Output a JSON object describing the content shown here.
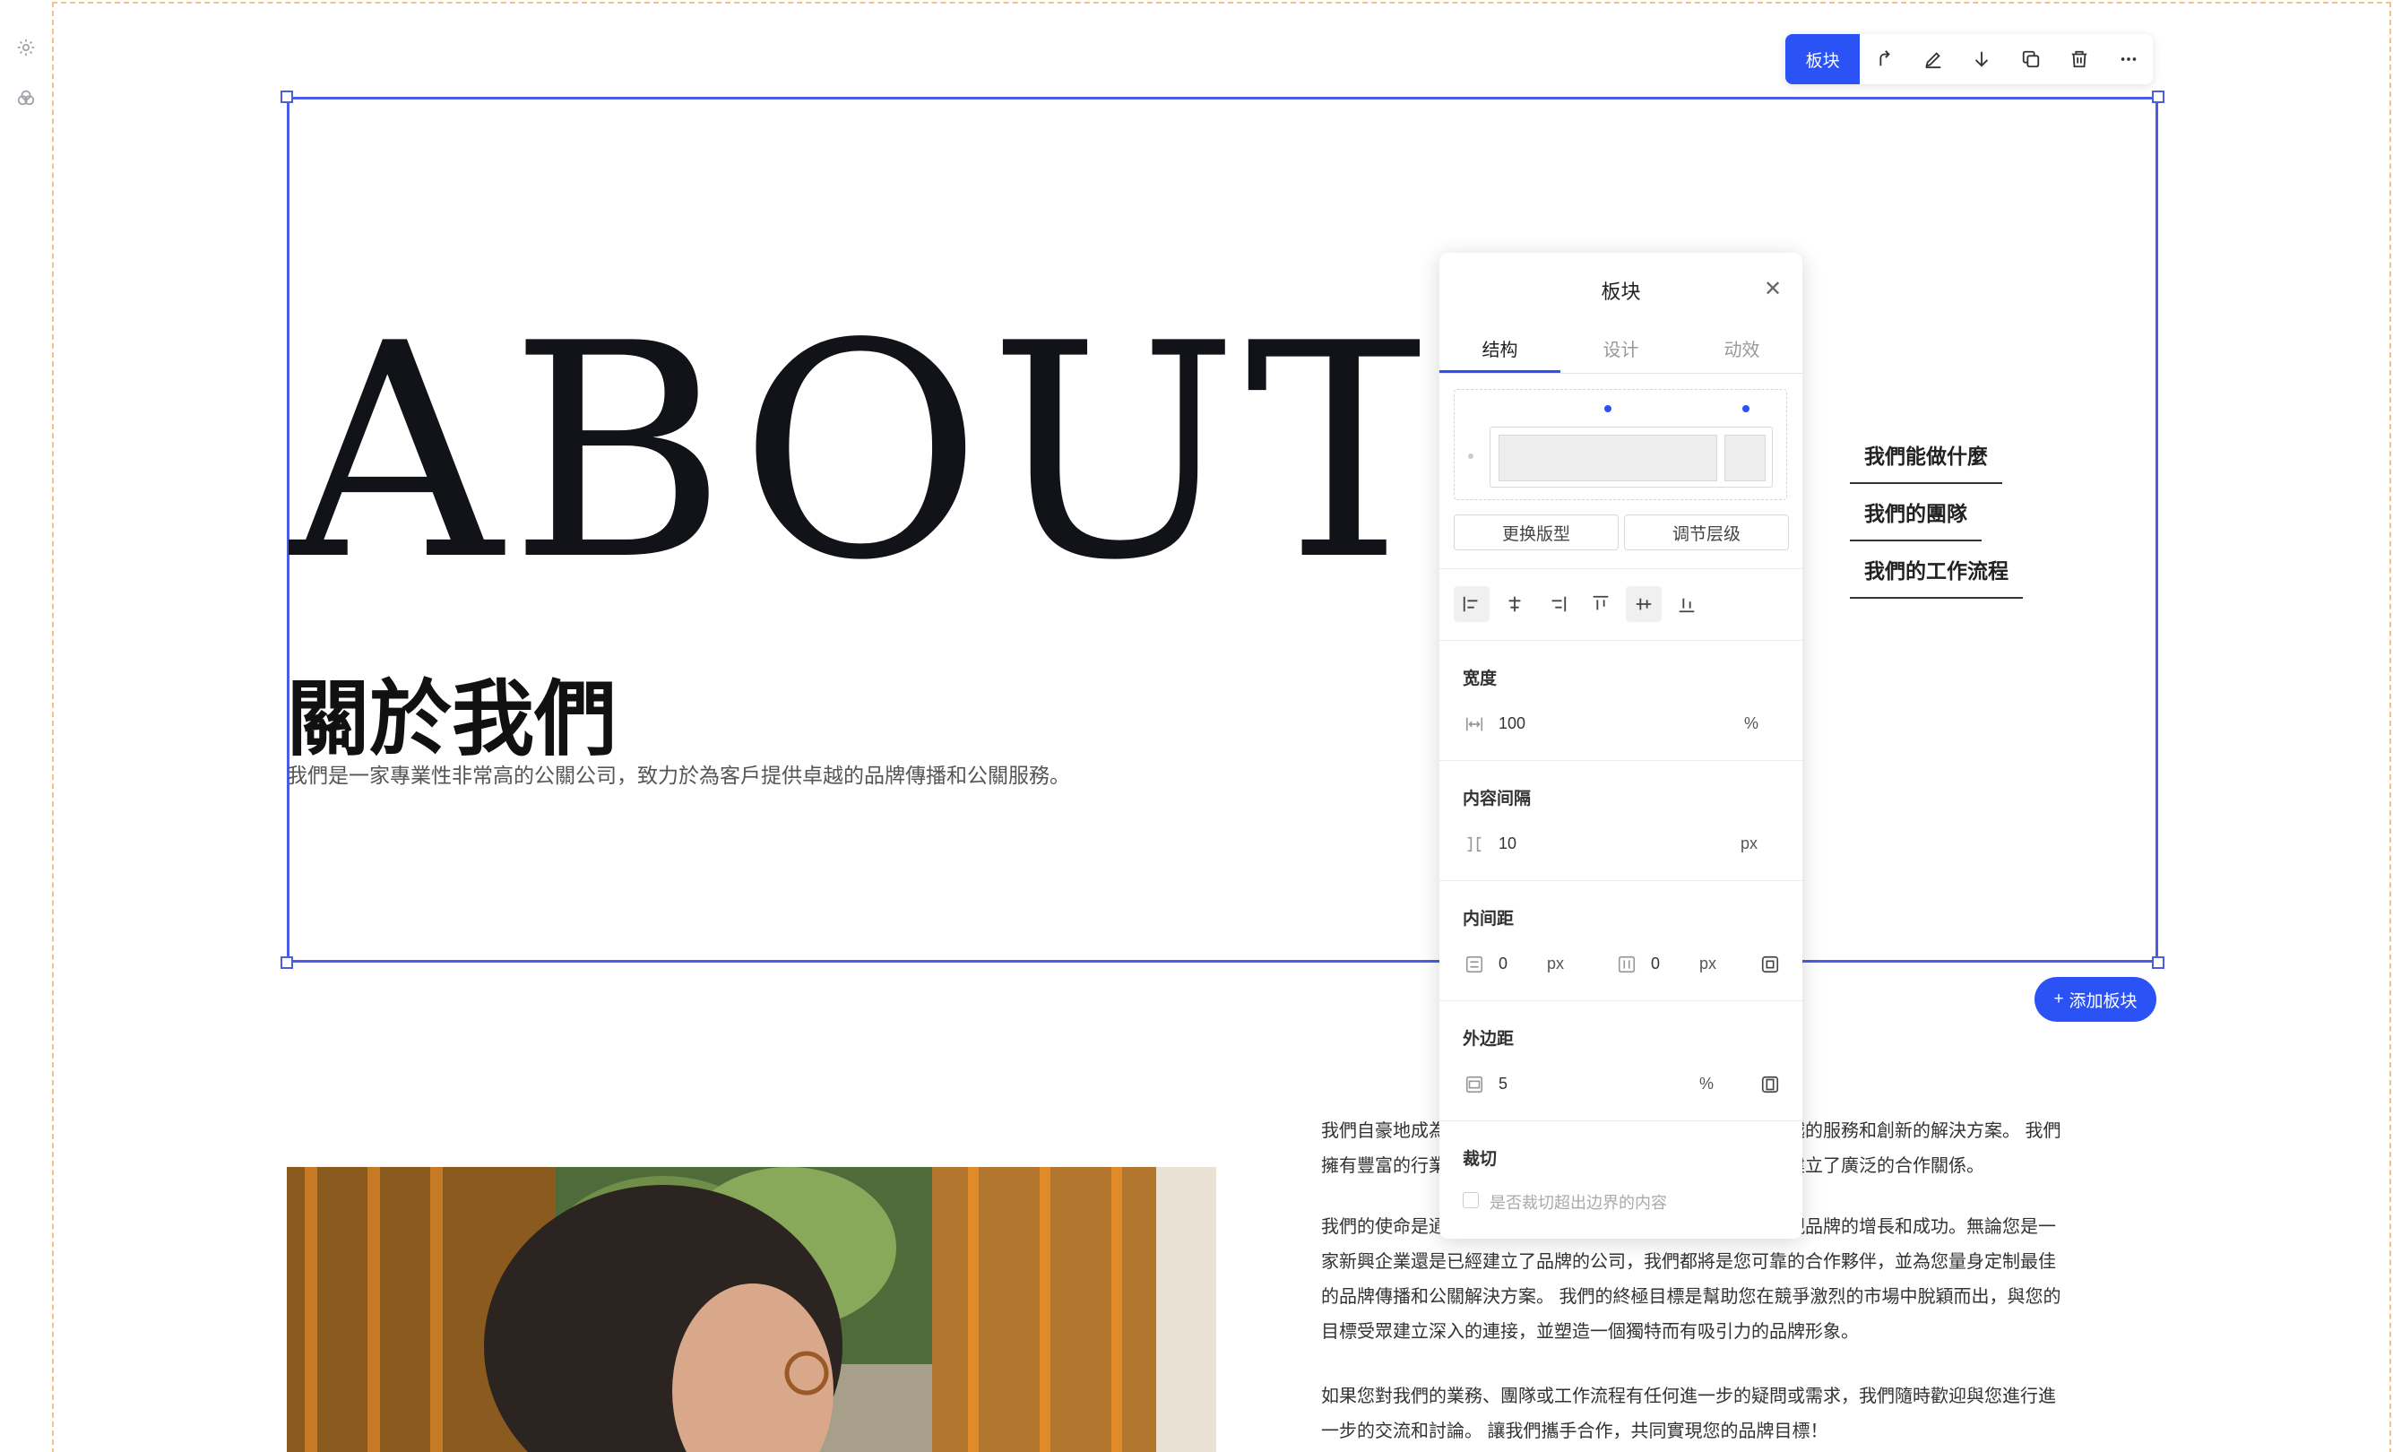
{
  "toolbar": {
    "block_label": "板块",
    "icons": [
      "move-up-icon",
      "edit-icon",
      "move-down-icon",
      "copy-icon",
      "delete-icon",
      "more-icon"
    ]
  },
  "hero": {
    "big_title": "ABOUT US",
    "cn_title": "關於我們",
    "cn_subtitle": "我們是一家專業性非常高的公關公司，致力於為客戶提供卓越的品牌傳播和公關服務。"
  },
  "side_nav": [
    "我們能做什麼",
    "我們的團隊",
    "我們的工作流程"
  ],
  "add_block_label": "添加板块",
  "paragraphs": [
    "我們自豪地成為一家專業的公關公司，為客戶提供專業、卓越的服務和創新的解決方案。 我們擁有豐富的行業經驗和專業的團隊，與眾多知名品牌和企業建立了廣泛的合作關係。",
    "我們的使命是通過專業的公關服務和傳播策略，幫助客戶實現品牌的增長和成功。無論您是一家新興企業還是已經建立了品牌的公司，我們都將是您可靠的合作夥伴，並為您量身定制最佳的品牌傳播和公關解決方案。 我們的終極目標是幫助您在競爭激烈的市場中脫穎而出，與您的目標受眾建立深入的連接，並塑造一個獨特而有吸引力的品牌形象。",
    "如果您對我們的業務、團隊或工作流程有任何進一步的疑問或需求，我們隨時歡迎與您進行進一步的交流和討論。 讓我們攜手合作，共同實現您的品牌目標！"
  ],
  "panel": {
    "title": "板块",
    "tabs": [
      "结构",
      "设计",
      "动效"
    ],
    "active_tab": "结构",
    "change_layout": "更换版型",
    "adjust_level": "调节层级",
    "width": {
      "label": "宽度",
      "value": "100",
      "unit": "%"
    },
    "gap": {
      "label": "内容间隔",
      "value": "10",
      "unit": "px"
    },
    "padding": {
      "label": "内间距",
      "v_value": "0",
      "v_unit": "px",
      "h_value": "0",
      "h_unit": "px"
    },
    "margin": {
      "label": "外边距",
      "value": "5",
      "unit": "%"
    },
    "clip": {
      "label": "裁切",
      "checkbox_label": "是否裁切超出边界的内容",
      "checked": false
    }
  },
  "colors": {
    "accent": "#2b52f5",
    "selection": "#4a5de6",
    "title": "#111318"
  }
}
